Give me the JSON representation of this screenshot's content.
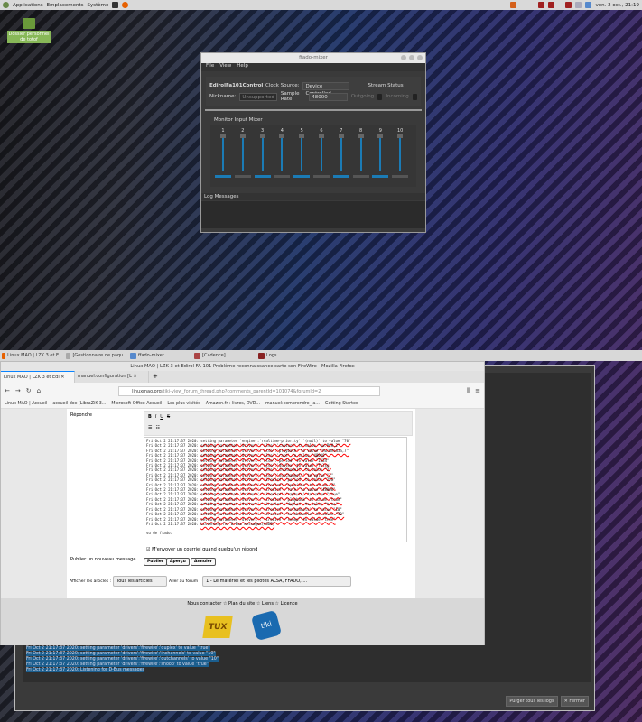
{
  "top_panel": {
    "menus": [
      "Applications",
      "Emplacements",
      "Système"
    ],
    "clock": "ven. 2 oct., 21:19"
  },
  "desktop": {
    "icon_label": "Dossier personnel de totof"
  },
  "ffado": {
    "title": "ffado-mixer",
    "menu": [
      "File",
      "View",
      "Help"
    ],
    "device": "EdirolFa101Control",
    "clock_source_label": "Clock Source:",
    "clock_source": "Device Controlled",
    "stream_status": "Stream Status",
    "nickname_label": "Nickname:",
    "nickname": "Unsupported",
    "sample_rate_label": "Sample Rate:",
    "sample_rate": "48000",
    "outgoing": "Outgoing",
    "incoming": "Incoming",
    "mixer_title": "Monitor Input Mixer",
    "channels": [
      "1",
      "2",
      "3",
      "4",
      "5",
      "6",
      "7",
      "8",
      "9",
      "10"
    ],
    "log_title": "Log Messages"
  },
  "taskbar": {
    "items": [
      "Linux MAO | LZK 3 et E...",
      "[Gestionnaire de paqu...",
      "ffado-mixer",
      "[Cadence]",
      "Logs"
    ]
  },
  "logs": {
    "lines": [
      "Fri Oct  2 21:17:37 2020: setting parameter 'drivers':'firewire':'playback' to value \"true\"",
      "Fri Oct  2 21:17:37 2020: setting parameter 'drivers':'firewire':'duplex' to value \"true\"",
      "Fri Oct  2 21:17:37 2020: setting parameter 'drivers':'firewire':'inchannels' to value \"10\"",
      "Fri Oct  2 21:17:37 2020: setting parameter 'drivers':'firewire':'outchannels' to value \"10\"",
      "Fri Oct  2 21:17:37 2020: setting parameter 'drivers':'firewire':'snoop' to value \"true\"",
      "Fri Oct  2 21:17:37 2020: Listening for D-Bus messages"
    ],
    "purge": "Purger tous les logs",
    "close": "✕ Fermer"
  },
  "firefox": {
    "title": "Linux MAO | LZK 3 et Edirol FA-101 Problème reconnaissance carte son FireWire - Mozilla Firefox",
    "tabs": [
      "Linux MAO | LZK 3 et Edi",
      "manuel:configuration [L"
    ],
    "url_domain": "linuxmao.org",
    "url_path": "/tiki-view_forum_thread.php?comments_parentId=101074&forumId=2",
    "bookmarks": [
      "Linux MAO | Accueil",
      "accueil doc [LibraZiK-3...",
      "Microsoft Office Accueil",
      "Les plus visités",
      "Amazon.fr : livres, DVD...",
      "manuel:comprendre_la...",
      "Getting Started"
    ],
    "reply_label": "Répondre",
    "editor_lines": [
      [
        "Fri Oct  2 21:17:37 2020: ",
        "setting parameter 'engine':'realtime-priority':'(null)' to value \"70\""
      ],
      [
        "Fri Oct  2 21:17:37 2020: ",
        "setting parameter 'drivers':'alsa':'capture' to value \"hw:PCH,2\""
      ],
      [
        "Fri Oct  2 21:17:37 2020: ",
        "setting parameter 'drivers':'alsa':'playback' to value \"hw:NVidia,7\""
      ],
      [
        "Fri Oct  2 21:17:37 2020: ",
        "setting parameter 'drivers':'alsa':'rate' to value \"48000\""
      ],
      [
        "Fri Oct  2 21:17:37 2020: ",
        "setting parameter 'drivers':'alsa':'period' to value \"1024\""
      ],
      [
        "Fri Oct  2 21:17:37 2020: ",
        "setting parameter 'drivers':'alsa':'duplex' to value \"false\""
      ],
      [
        "Fri Oct  2 21:17:37 2020: ",
        "setting parameter 'drivers':'alsa':'inchannels' to value \"2\""
      ],
      [
        "Fri Oct  2 21:17:37 2020: ",
        "setting parameter 'drivers':'alsa':'outchannels' to value \"2\""
      ],
      [
        "Fri Oct  2 21:17:37 2020: ",
        "setting parameter 'drivers':'firewire':'period' to value \"256\""
      ],
      [
        "Fri Oct  2 21:17:37 2020: ",
        "setting parameter 'drivers':'firewire':'nperiods' to value \"4\""
      ],
      [
        "Fri Oct  2 21:17:37 2020: ",
        "setting parameter 'drivers':'firewire':'rate' to value \"48000\""
      ],
      [
        "Fri Oct  2 21:17:37 2020: ",
        "setting parameter 'drivers':'firewire':'capture' to value \"true\""
      ],
      [
        "Fri Oct  2 21:17:37 2020: ",
        "setting parameter 'drivers':'firewire':'playback' to value \"true\""
      ],
      [
        "Fri Oct  2 21:17:37 2020: ",
        "setting parameter 'drivers':'firewire':'duplex' to value \"true\""
      ],
      [
        "Fri Oct  2 21:17:37 2020: ",
        "setting parameter 'drivers':'firewire':'inchannels' to value \"10\""
      ],
      [
        "Fri Oct  2 21:17:37 2020: ",
        "setting parameter 'drivers':'firewire':'outchannels' to value \"10\""
      ],
      [
        "Fri Oct  2 21:17:37 2020: ",
        "setting parameter 'drivers':'firewire':'snoop' to value \"true\""
      ],
      [
        "Fri Oct  2 21:17:37 2020: ",
        "Listening for D-Bus messages(CODE)"
      ]
    ],
    "editor_tail": "vu de ffado:",
    "notify": "M'envoyer un courriel quand quelqu'un répond",
    "publish_label": "Publier un nouveau message",
    "btn_publish": "Publier",
    "btn_preview": "Aperçu",
    "btn_cancel": "Annuler",
    "show_label": "Afficher les articles :",
    "show_value": "Tous les articles",
    "forum_label": "Aller au forum :",
    "forum_value": "1 - Le matériel et les pilotes ALSA, FFADO, ...",
    "footer_links": [
      "Nous contacter",
      "Plan du site",
      "Liens",
      "Licence"
    ],
    "logo_tux": "TUX",
    "logo_tiki": "tiki"
  }
}
